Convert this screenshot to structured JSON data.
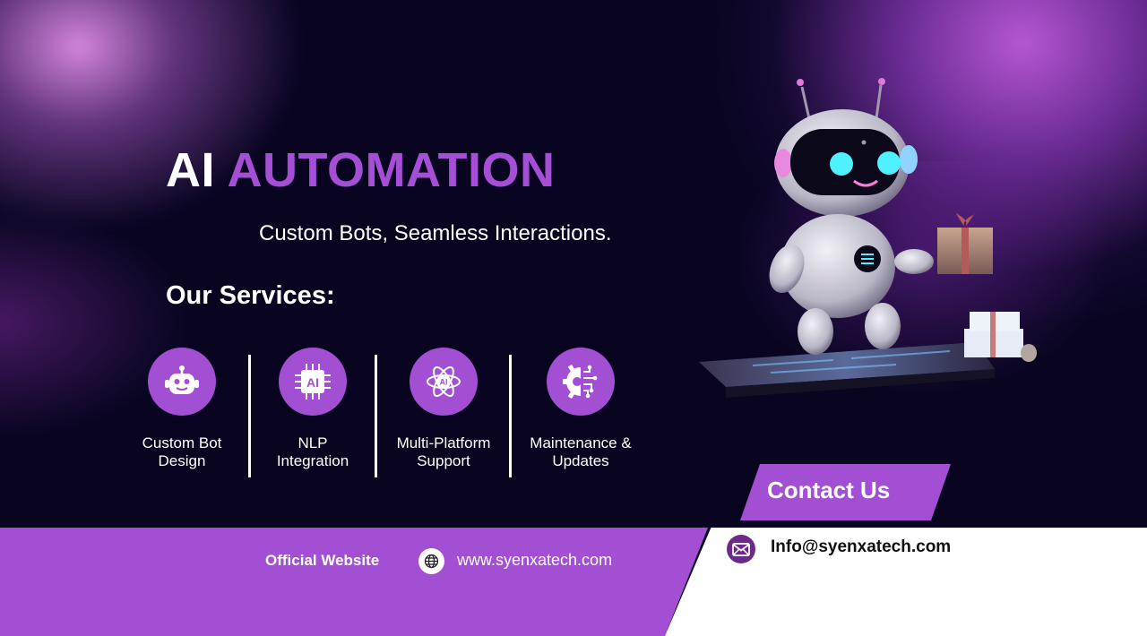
{
  "hero": {
    "title_white": "AI",
    "title_accent": "AUTOMATION",
    "tagline": "Custom Bots, Seamless Interactions."
  },
  "services": {
    "heading": "Our Services:",
    "items": [
      {
        "line1": "Custom Bot",
        "line2": "Design",
        "icon": "robot-face-icon"
      },
      {
        "line1": "NLP",
        "line2": "Integration",
        "icon": "ai-chip-icon"
      },
      {
        "line1": "Multi-Platform",
        "line2": "Support",
        "icon": "ai-atom-icon"
      },
      {
        "line1": "Maintenance &",
        "line2": "Updates",
        "icon": "gear-circuit-icon"
      }
    ]
  },
  "footer": {
    "official_label": "Official Website",
    "website": "www.syenxatech.com",
    "contact_heading": "Contact Us",
    "email": "Info@syenxatech.com"
  },
  "colors": {
    "background": "#090521",
    "accent": "#a44fd6",
    "footer_purple": "#a34fd3",
    "white": "#ffffff"
  }
}
